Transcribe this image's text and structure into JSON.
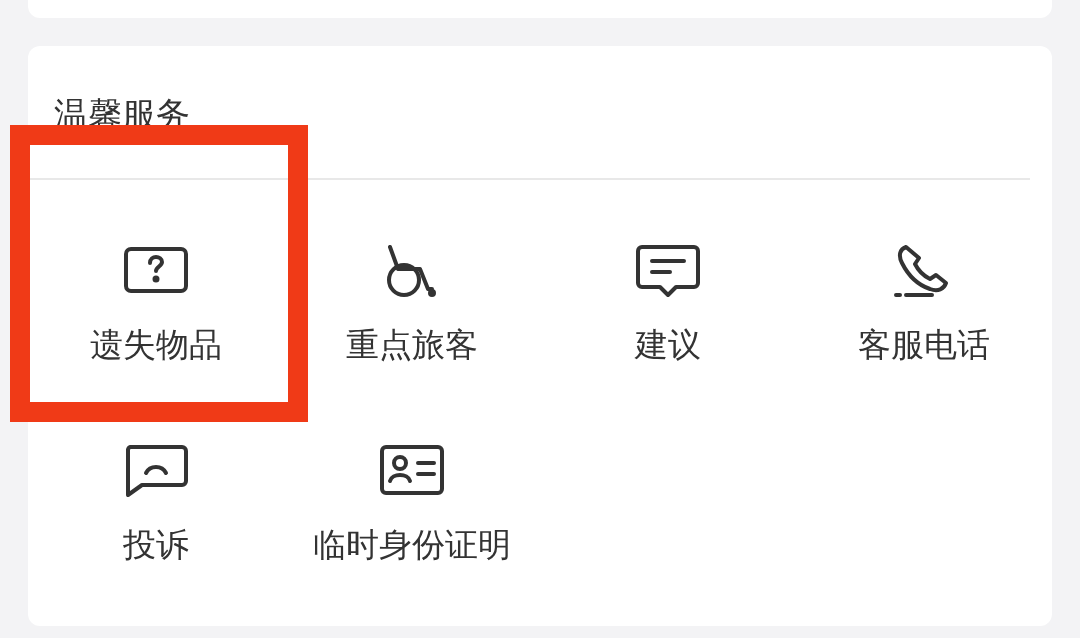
{
  "section": {
    "title": "温馨服务",
    "items": [
      {
        "label": "遗失物品",
        "kind": "lost",
        "highlighted": true
      },
      {
        "label": "重点旅客",
        "kind": "wheelchair",
        "highlighted": false
      },
      {
        "label": "建议",
        "kind": "suggest",
        "highlighted": false
      },
      {
        "label": "客服电话",
        "kind": "phone",
        "highlighted": false
      },
      {
        "label": "投诉",
        "kind": "complain",
        "highlighted": false
      },
      {
        "label": "临时身份证明",
        "kind": "idcard",
        "highlighted": false
      }
    ]
  }
}
